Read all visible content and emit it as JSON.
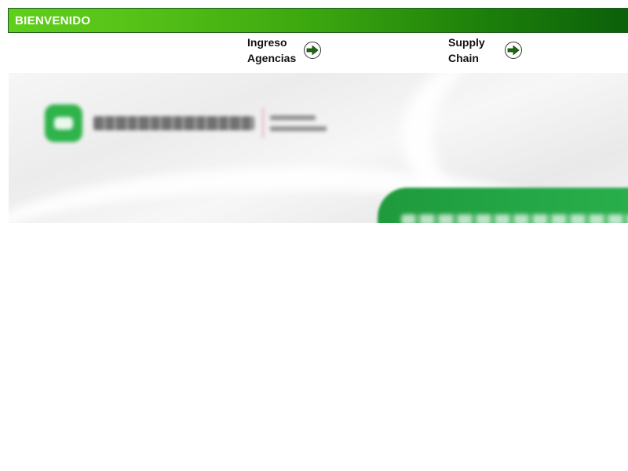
{
  "header": {
    "title": "BIENVENIDO",
    "gradient_start": "#5fce1c",
    "gradient_end": "#0b600a"
  },
  "nav": {
    "ingreso": {
      "line1": "Ingreso",
      "line2": "Agencias",
      "icon": "arrow-right-icon"
    },
    "supply": {
      "line1": "Supply",
      "line2": "Chain",
      "icon": "arrow-right-icon"
    }
  },
  "banner": {
    "brand_color": "#2fb34a",
    "accent_color": "#25a948"
  }
}
